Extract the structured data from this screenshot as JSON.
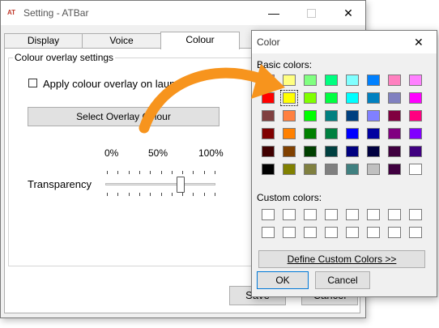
{
  "settings": {
    "app_icon": "AT",
    "title": "Setting - ATBar",
    "tabs": [
      "Display",
      "Voice",
      "Colour"
    ],
    "active_tab": "Colour",
    "group_label": "Colour overlay settings",
    "overlay_checkbox_label": "Apply colour overlay on launch",
    "overlay_checked": false,
    "select_colour_label": "Select Overlay Colour",
    "pct_0": "0%",
    "pct_50": "50%",
    "pct_100": "100%",
    "transparency_label": "Transparency",
    "transparency_value": 0.7,
    "save_label": "Save",
    "cancel_label": "Cancel"
  },
  "color_dialog": {
    "title": "Color",
    "basic_colors_label": "Basic colors:",
    "custom_colors_label": "Custom colors:",
    "define_label": "Define Custom Colors >>",
    "ok_label": "OK",
    "cancel_label": "Cancel",
    "selected_swatch": [
      1,
      1
    ],
    "basic_colors": [
      [
        "#ff8080",
        "#ffff80",
        "#80ff80",
        "#00ff80",
        "#80ffff",
        "#0080ff",
        "#ff80c0",
        "#ff80ff"
      ],
      [
        "#ff0000",
        "#ffff00",
        "#80ff00",
        "#00ff40",
        "#00ffff",
        "#0080c0",
        "#8080c0",
        "#ff00ff"
      ],
      [
        "#804040",
        "#ff8040",
        "#00ff00",
        "#008080",
        "#004080",
        "#8080ff",
        "#800040",
        "#ff0080"
      ],
      [
        "#800000",
        "#ff8000",
        "#008000",
        "#008040",
        "#0000ff",
        "#0000a0",
        "#800080",
        "#8000ff"
      ],
      [
        "#400000",
        "#804000",
        "#004000",
        "#004040",
        "#000080",
        "#000040",
        "#400040",
        "#400080"
      ],
      [
        "#000000",
        "#808000",
        "#808040",
        "#808080",
        "#408080",
        "#c0c0c0",
        "#400040",
        "#ffffff"
      ]
    ]
  },
  "colors": {
    "arrow": "#f7941d"
  }
}
